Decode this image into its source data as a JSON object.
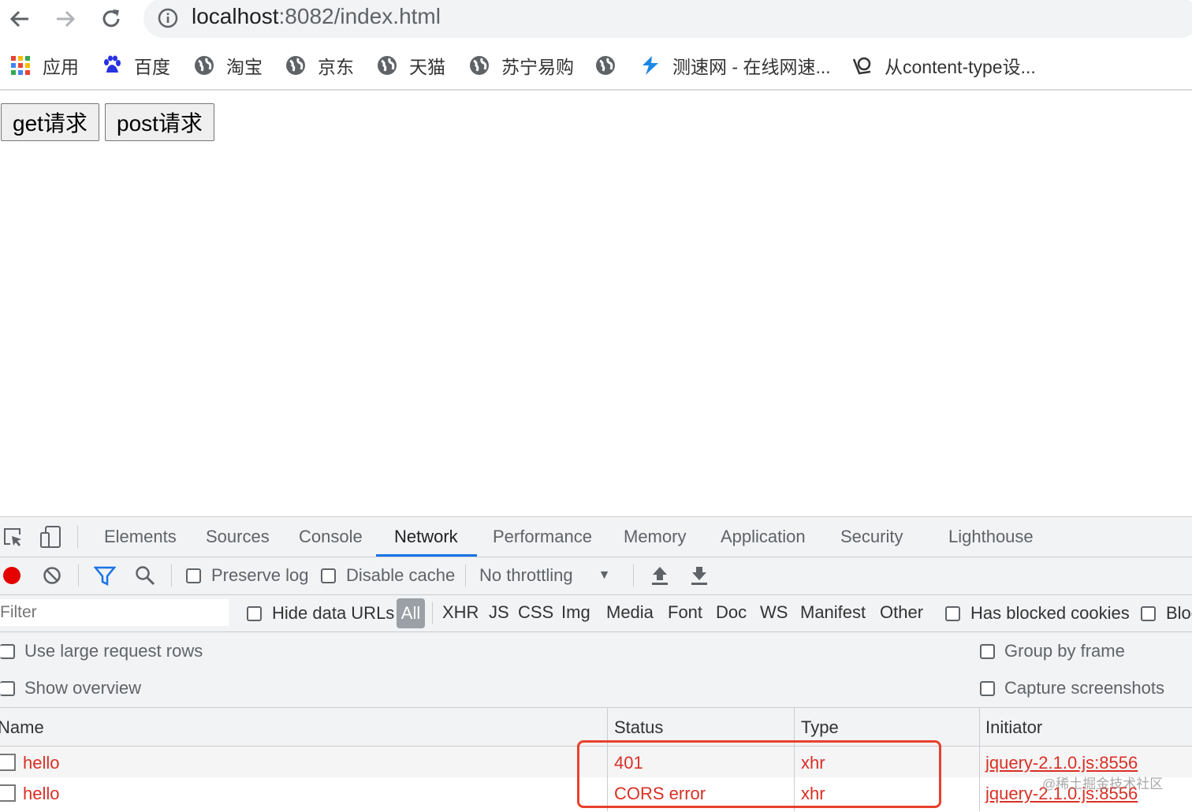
{
  "browser": {
    "url_host": "localhost",
    "url_rest": ":8082/index.html",
    "bookmarks": [
      {
        "label": "应用",
        "icon": "apps-grid-icon"
      },
      {
        "label": "百度",
        "icon": "baidu-paw-icon"
      },
      {
        "label": "淘宝",
        "icon": "globe-icon"
      },
      {
        "label": "京东",
        "icon": "globe-icon"
      },
      {
        "label": "天猫",
        "icon": "globe-icon"
      },
      {
        "label": "苏宁易购",
        "icon": "globe-icon"
      },
      {
        "label": "",
        "icon": "globe-icon"
      },
      {
        "label": "测速网 - 在线网速...",
        "icon": "speedtest-icon"
      },
      {
        "label": "从content-type设...",
        "icon": "juejin-icon"
      }
    ]
  },
  "page": {
    "get_button": "get请求",
    "post_button": "post请求"
  },
  "devtools": {
    "tabs": [
      "Elements",
      "Sources",
      "Console",
      "Network",
      "Performance",
      "Memory",
      "Application",
      "Security",
      "Lighthouse"
    ],
    "active_tab": "Network",
    "toolbar": {
      "preserve_log": "Preserve log",
      "disable_cache": "Disable cache",
      "throttling": "No throttling"
    },
    "filter": {
      "placeholder": "Filter",
      "hide_data_urls": "Hide data URLs",
      "types": [
        "All",
        "XHR",
        "JS",
        "CSS",
        "Img",
        "Media",
        "Font",
        "Doc",
        "WS",
        "Manifest",
        "Other"
      ],
      "has_blocked_cookies": "Has blocked cookies",
      "blocked_requests": "Bloc"
    },
    "options": {
      "large_rows": "Use large request rows",
      "group_by_frame": "Group by frame",
      "show_overview": "Show overview",
      "capture_screenshots": "Capture screenshots"
    },
    "columns": [
      "Name",
      "Status",
      "Type",
      "Initiator"
    ],
    "rows": [
      {
        "name": "hello",
        "status": "401",
        "type": "xhr",
        "initiator": "jquery-2.1.0.js:8556"
      },
      {
        "name": "hello",
        "status": "CORS error",
        "type": "xhr",
        "initiator": "jquery-2.1.0.js:8556"
      }
    ],
    "error_color": "#d93025",
    "accent_color": "#1a73e8"
  },
  "watermark": "@稀土掘金技术社区"
}
